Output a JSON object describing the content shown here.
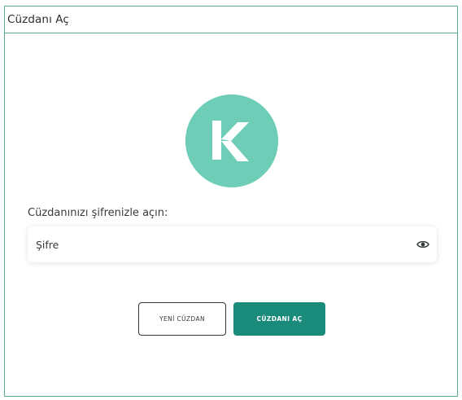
{
  "dialog": {
    "title": "Cüzdanı Aç"
  },
  "logo": {
    "icon": "kaspa-logo-icon",
    "color": "#6ecdb7"
  },
  "form": {
    "label": "Cüzdanınızı şifrenizle açın:",
    "password_placeholder": "Şifre",
    "password_value": "",
    "toggle_icon": "eye-icon"
  },
  "actions": {
    "new_wallet_label": "YENİ CÜZDAN",
    "open_wallet_label": "CÜZDANI AÇ",
    "accent_color": "#1a8a7b"
  }
}
